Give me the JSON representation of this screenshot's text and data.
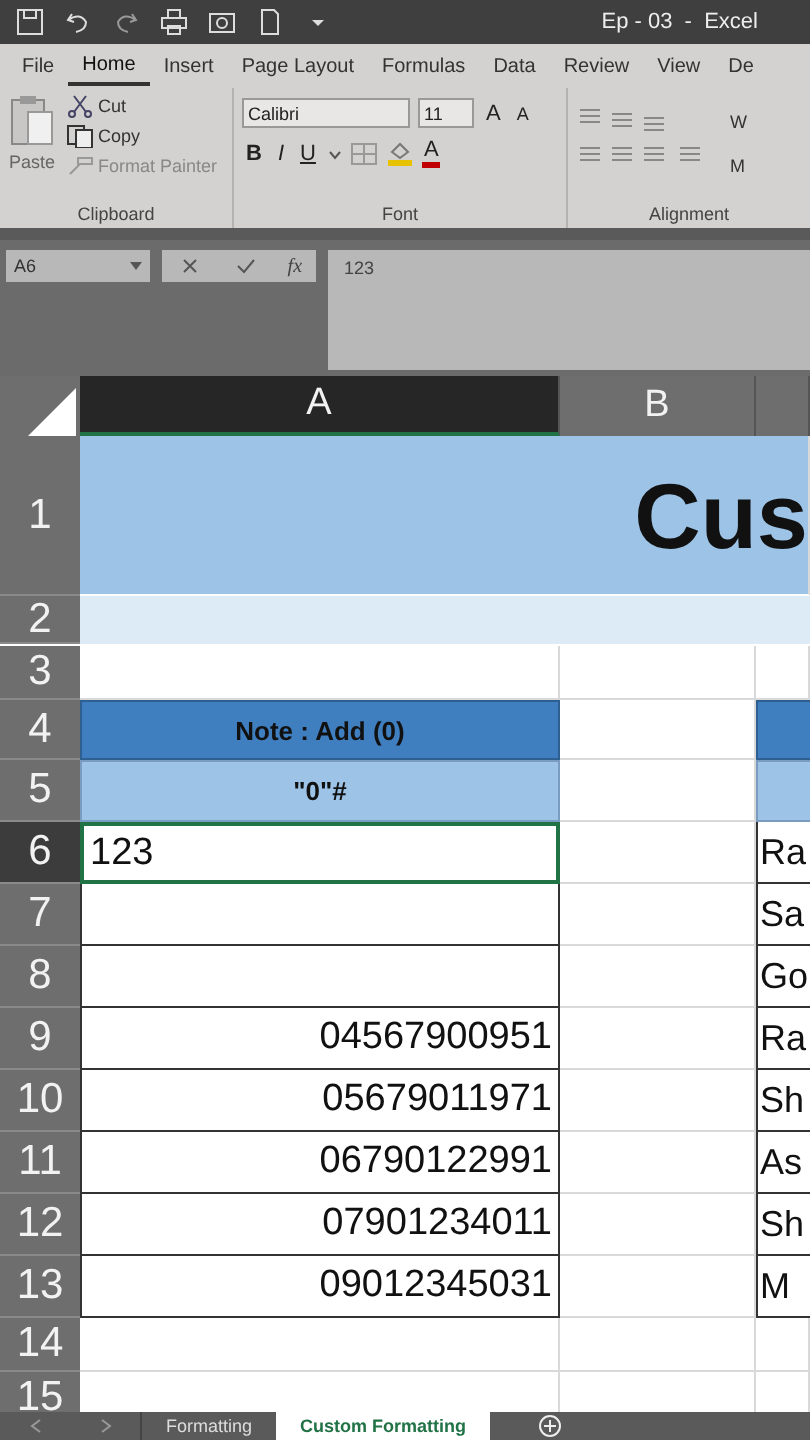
{
  "title_bar": {
    "title": "Ep - 03  -  Excel"
  },
  "menu_tabs": [
    {
      "label": "File",
      "selected": false
    },
    {
      "label": "Home",
      "selected": true
    },
    {
      "label": "Insert",
      "selected": false
    },
    {
      "label": "Page Layout",
      "selected": false
    },
    {
      "label": "Formulas",
      "selected": false
    },
    {
      "label": "Data",
      "selected": false
    },
    {
      "label": "Review",
      "selected": false
    },
    {
      "label": "View",
      "selected": false
    },
    {
      "label": "De",
      "selected": false
    }
  ],
  "ribbon": {
    "clipboard": {
      "paste": "Paste",
      "cut": "Cut",
      "copy": "Copy",
      "format_painter": "Format Painter",
      "format_painter_disabled": true,
      "label": "Clipboard"
    },
    "font": {
      "name": "Calibri",
      "size": "11",
      "grow": "A",
      "shrink": "A",
      "styles": [
        "B",
        "I",
        "U"
      ],
      "font_color": "A",
      "label": "Font"
    },
    "alignment": {
      "wrap": "W",
      "merge": "M",
      "label": "Alignment"
    }
  },
  "formula_bar": {
    "name_box": "A6",
    "function_label": "fx",
    "value": "123"
  },
  "columns": [
    {
      "label": "A",
      "selected": true
    },
    {
      "label": "B",
      "selected": false
    }
  ],
  "rows": [
    {
      "number": "1",
      "kind": "title",
      "selected": false,
      "text": "Cus"
    },
    {
      "number": "2",
      "kind": "band",
      "selected": false
    },
    {
      "number": "3",
      "kind": "blank",
      "selected": false
    },
    {
      "number": "4",
      "kind": "header",
      "selected": false,
      "a": "Note : Add (0)"
    },
    {
      "number": "5",
      "kind": "subheader",
      "selected": false,
      "a": "\"0\"#"
    },
    {
      "number": "6",
      "kind": "entry",
      "selected": true,
      "a": "123",
      "c": "Ra"
    },
    {
      "number": "7",
      "kind": "data",
      "selected": false,
      "c": "Sa"
    },
    {
      "number": "8",
      "kind": "data",
      "selected": false,
      "c": "Go"
    },
    {
      "number": "9",
      "kind": "data",
      "selected": false,
      "a": "04567900951",
      "c": "Ra"
    },
    {
      "number": "10",
      "kind": "data",
      "selected": false,
      "a": "05679011971",
      "c": "Sh"
    },
    {
      "number": "11",
      "kind": "data",
      "selected": false,
      "a": "06790122991",
      "c": "As"
    },
    {
      "number": "12",
      "kind": "data",
      "selected": false,
      "a": "07901234011",
      "c": "Sh"
    },
    {
      "number": "13",
      "kind": "data",
      "selected": false,
      "a": "09012345031",
      "c": "M"
    },
    {
      "number": "14",
      "kind": "blank",
      "selected": false
    },
    {
      "number": "15",
      "kind": "blank",
      "selected": false
    }
  ],
  "sheet_tabs": [
    {
      "label": "Formatting",
      "selected": false
    },
    {
      "label": "Custom Formatting",
      "selected": true
    }
  ]
}
